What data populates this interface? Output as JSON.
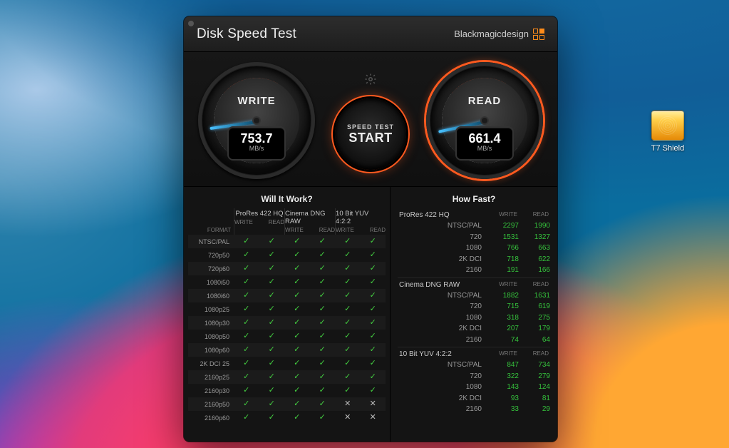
{
  "desktop": {
    "drive_label": "T7 Shield"
  },
  "window": {
    "title": "Disk Speed Test",
    "brand": "Blackmagicdesign",
    "gear_icon": "settings",
    "start": {
      "line1": "SPEED TEST",
      "line2": "START"
    },
    "gauges": {
      "write": {
        "label": "WRITE",
        "value": "753.7",
        "unit": "MB/s",
        "needle_deg": 172
      },
      "read": {
        "label": "READ",
        "value": "661.4",
        "unit": "MB/s",
        "needle_deg": 168
      }
    }
  },
  "will_it_work": {
    "title": "Will It Work?",
    "format_header": "FORMAT",
    "sub_write": "WRITE",
    "sub_read": "READ",
    "codecs": [
      "ProRes 422 HQ",
      "Cinema DNG RAW",
      "10 Bit YUV 4:2:2"
    ],
    "rows": [
      {
        "fmt": "NTSC/PAL",
        "cells": [
          1,
          1,
          1,
          1,
          1,
          1
        ]
      },
      {
        "fmt": "720p50",
        "cells": [
          1,
          1,
          1,
          1,
          1,
          1
        ]
      },
      {
        "fmt": "720p60",
        "cells": [
          1,
          1,
          1,
          1,
          1,
          1
        ]
      },
      {
        "fmt": "1080i50",
        "cells": [
          1,
          1,
          1,
          1,
          1,
          1
        ]
      },
      {
        "fmt": "1080i60",
        "cells": [
          1,
          1,
          1,
          1,
          1,
          1
        ]
      },
      {
        "fmt": "1080p25",
        "cells": [
          1,
          1,
          1,
          1,
          1,
          1
        ]
      },
      {
        "fmt": "1080p30",
        "cells": [
          1,
          1,
          1,
          1,
          1,
          1
        ]
      },
      {
        "fmt": "1080p50",
        "cells": [
          1,
          1,
          1,
          1,
          1,
          1
        ]
      },
      {
        "fmt": "1080p60",
        "cells": [
          1,
          1,
          1,
          1,
          1,
          1
        ]
      },
      {
        "fmt": "2K DCI 25",
        "cells": [
          1,
          1,
          1,
          1,
          1,
          1
        ]
      },
      {
        "fmt": "2160p25",
        "cells": [
          1,
          1,
          1,
          1,
          1,
          1
        ]
      },
      {
        "fmt": "2160p30",
        "cells": [
          1,
          1,
          1,
          1,
          1,
          1
        ]
      },
      {
        "fmt": "2160p50",
        "cells": [
          1,
          1,
          1,
          1,
          0,
          0
        ]
      },
      {
        "fmt": "2160p60",
        "cells": [
          1,
          1,
          1,
          1,
          0,
          0
        ]
      }
    ]
  },
  "how_fast": {
    "title": "How Fast?",
    "col_write": "WRITE",
    "col_read": "READ",
    "groups": [
      {
        "name": "ProRes 422 HQ",
        "rows": [
          {
            "res": "NTSC/PAL",
            "w": "2297",
            "r": "1990"
          },
          {
            "res": "720",
            "w": "1531",
            "r": "1327"
          },
          {
            "res": "1080",
            "w": "766",
            "r": "663"
          },
          {
            "res": "2K DCI",
            "w": "718",
            "r": "622"
          },
          {
            "res": "2160",
            "w": "191",
            "r": "166"
          }
        ]
      },
      {
        "name": "Cinema DNG RAW",
        "rows": [
          {
            "res": "NTSC/PAL",
            "w": "1882",
            "r": "1631"
          },
          {
            "res": "720",
            "w": "715",
            "r": "619"
          },
          {
            "res": "1080",
            "w": "318",
            "r": "275"
          },
          {
            "res": "2K DCI",
            "w": "207",
            "r": "179"
          },
          {
            "res": "2160",
            "w": "74",
            "r": "64"
          }
        ]
      },
      {
        "name": "10 Bit YUV 4:2:2",
        "rows": [
          {
            "res": "NTSC/PAL",
            "w": "847",
            "r": "734"
          },
          {
            "res": "720",
            "w": "322",
            "r": "279"
          },
          {
            "res": "1080",
            "w": "143",
            "r": "124"
          },
          {
            "res": "2K DCI",
            "w": "93",
            "r": "81"
          },
          {
            "res": "2160",
            "w": "33",
            "r": "29"
          }
        ]
      }
    ]
  }
}
